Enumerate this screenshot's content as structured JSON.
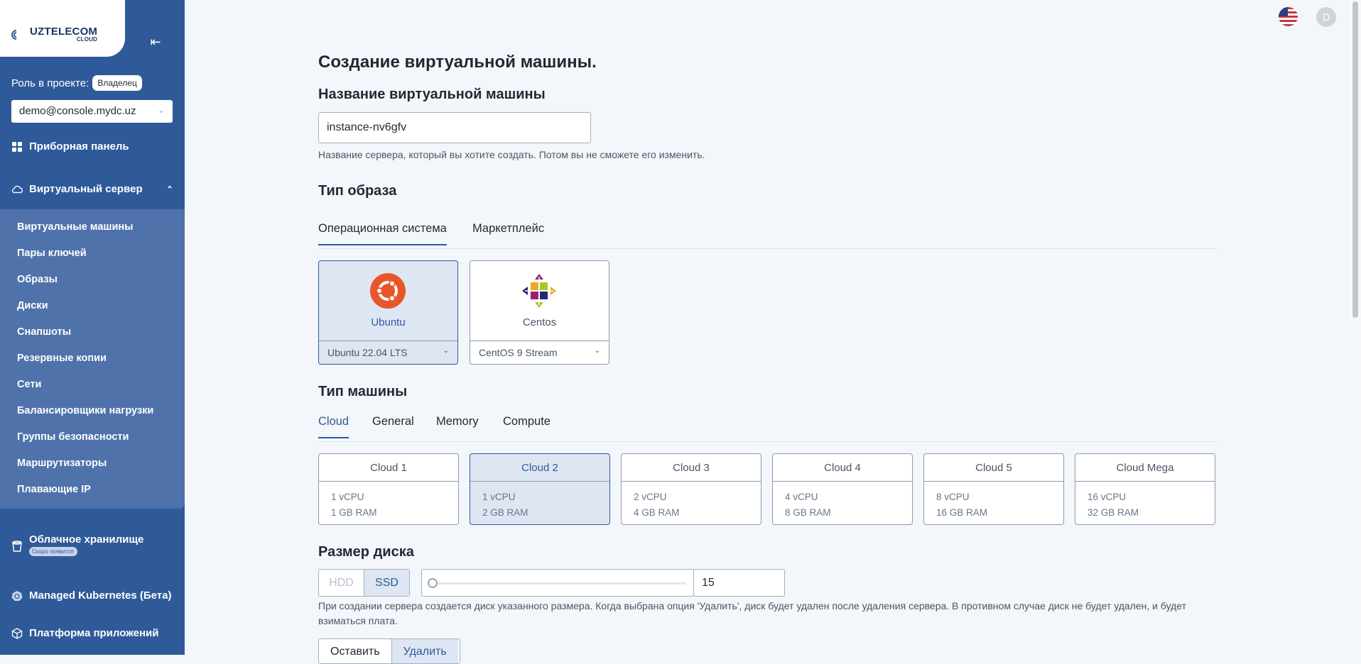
{
  "sidebar": {
    "logo_main": "UZTELECOM",
    "logo_sub": "CLOUD",
    "role_label": "Роль в проекте:",
    "role_value": "Владелец",
    "account": "demo@console.mydc.uz",
    "dashboard": "Приборная панель",
    "virtual_server": "Виртуальный сервер",
    "sub_items": [
      "Виртуальные машины",
      "Пары ключей",
      "Образы",
      "Диски",
      "Снапшоты",
      "Резервные копии",
      "Сети",
      "Балансировщики нагрузки",
      "Группы безопасности",
      "Маршрутизаторы",
      "Плавающие IP"
    ],
    "storage": "Облачное хранилище",
    "storage_badge": "Скоро появится",
    "kubernetes": "Managed Kubernetes (Бета)",
    "apps": "Платформа приложений"
  },
  "header": {
    "avatar_letter": "D"
  },
  "main": {
    "title": "Создание виртуальной машины.",
    "name_heading": "Название виртуальной машины",
    "name_value": "instance-nv6gfv",
    "name_hint": "Название сервера, который вы хотите создать. Потом вы не сможете его изменить.",
    "image_heading": "Тип образа",
    "image_tabs": [
      "Операционная система",
      "Маркетплейс"
    ],
    "os": [
      {
        "name": "Ubuntu",
        "version": "Ubuntu 22.04 LTS"
      },
      {
        "name": "Centos",
        "version": "CentOS 9 Stream"
      }
    ],
    "machine_heading": "Тип машины",
    "machine_tabs": [
      "Cloud",
      "General",
      "Memory",
      "Compute"
    ],
    "plans": [
      {
        "name": "Cloud 1",
        "cpu": "1 vCPU",
        "ram": "1 GB RAM"
      },
      {
        "name": "Cloud 2",
        "cpu": "1 vCPU",
        "ram": "2 GB RAM"
      },
      {
        "name": "Cloud 3",
        "cpu": "2 vCPU",
        "ram": "4 GB RAM"
      },
      {
        "name": "Cloud 4",
        "cpu": "4 vCPU",
        "ram": "8 GB RAM"
      },
      {
        "name": "Cloud 5",
        "cpu": "8 vCPU",
        "ram": "16 GB RAM"
      },
      {
        "name": "Cloud Mega",
        "cpu": "16 vCPU",
        "ram": "32 GB RAM"
      }
    ],
    "disk_heading": "Размер диска",
    "disk_types": [
      "HDD",
      "SSD"
    ],
    "disk_size": "15",
    "disk_hint": "При создании сервера создается диск указанного размера. Когда выбрана опция 'Удалить', диск будет удален после удаления сервера. В противном случае диск не будет удален, и будет взиматься плата.",
    "disk_delete_options": [
      "Оставить",
      "Удалить"
    ]
  }
}
